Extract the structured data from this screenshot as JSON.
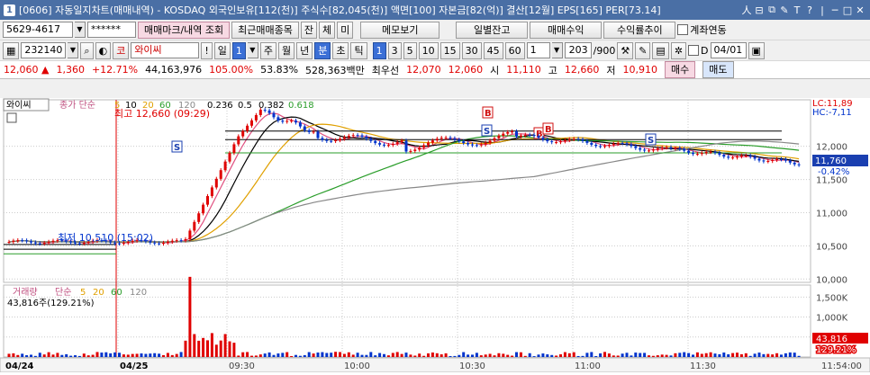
{
  "title": {
    "num": "1",
    "text": "[0606] 자동일지차트(매매내역) - KOSDAQ 외국인보유[112(천)] 주식수[82,045(천)] 액면[100] 자본금[82(억)] 결산[12월] EPS[165] PER[73.14]",
    "buttons": [
      "人",
      "⊟",
      "⧉",
      "✎",
      "T",
      "?",
      "|",
      "─",
      "□",
      "✕"
    ]
  },
  "toolbar1": {
    "account": "5629-4617",
    "password": "******",
    "buttons": [
      "매매마크/내역 조회",
      "최근매매종목",
      "잔",
      "체",
      "미",
      "메모보기",
      "일별잔고",
      "매매수익",
      "수익률추이"
    ],
    "link_label": "계좌연동"
  },
  "toolbar2": {
    "code": "232140",
    "market": "코",
    "name": "와이씨",
    "mark": "!",
    "ask": "일",
    "period_value": "1",
    "periods": [
      "주",
      "월",
      "년",
      "분",
      "초",
      "틱"
    ],
    "intervals": [
      "1",
      "3",
      "5",
      "10",
      "15",
      "30",
      "45",
      "60"
    ],
    "count_value": "1",
    "range": "203",
    "range_total": "/900",
    "d_label": "D",
    "date": "04/01"
  },
  "pricebar": {
    "price": "12,060",
    "change": "1,360",
    "change_pct": "+12.71%",
    "volume": "44,163,976",
    "vol_ratio": "105.00%",
    "turnover": "53.83%",
    "amount": "528,363백만",
    "bid_label": "최우선",
    "bid1": "12,070",
    "bid2": "12,060",
    "open_label": "시",
    "open": "11,110",
    "high_label": "고",
    "high": "12,660",
    "low_label": "저",
    "low": "10,910",
    "buy": "매수",
    "sell": "매도"
  },
  "chart_data": {
    "type": "candlestick",
    "legend": {
      "name": "와이씨",
      "price_label": "종가 단순",
      "mas": [
        "5",
        "10",
        "20",
        "60",
        "120"
      ],
      "fib_values": [
        "0.236",
        "0.5",
        "0.382",
        "0.618"
      ]
    },
    "annotations": {
      "high": "최고 12,660 (09:29)",
      "low": "최저 10,510 (15:02)"
    },
    "right_labels": {
      "lc": "LC:11,89",
      "hc": "HC:-7,11",
      "current": "11,760",
      "current_pct": "-0.42%"
    },
    "y_ticks": [
      "12,000",
      "11,500",
      "11,000",
      "10,500",
      "10,000"
    ],
    "ylim": [
      9950,
      12700
    ],
    "volume": {
      "title": "거래량",
      "ma_label": "단순",
      "mas": [
        "5",
        "20",
        "60",
        "120"
      ],
      "value": "43,816주(129.21%)",
      "y_ticks": [
        "1,500K",
        "1,000K",
        "500K"
      ],
      "current": "43,816",
      "current_pct": "129.21%"
    },
    "x_labels": [
      "04/24",
      "04/25",
      "09:30",
      "10:00",
      "10:30",
      "11:00",
      "11:30",
      "11:54:00"
    ],
    "trade_marks": [
      "S",
      "B",
      "S",
      "B",
      "B",
      "S"
    ]
  },
  "colors": {
    "titlebar": "#4a6fa5",
    "up": "#e00000",
    "down": "#0033cc",
    "ma5": "#e0a000",
    "ma20": "#2a9d2a",
    "ma120": "#888888"
  }
}
